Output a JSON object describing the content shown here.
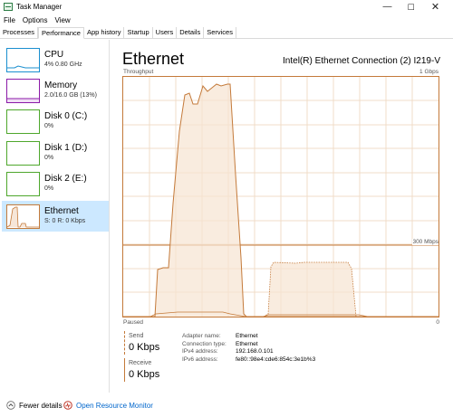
{
  "window": {
    "title": "Task Manager",
    "minimize_glyph": "—",
    "maximize_glyph": "☐",
    "close_glyph": "✕"
  },
  "menu": [
    "File",
    "Options",
    "View"
  ],
  "tabs": [
    "Processes",
    "Performance",
    "App history",
    "Startup",
    "Users",
    "Details",
    "Services"
  ],
  "active_tab": "Performance",
  "sidebar": {
    "items": [
      {
        "title": "CPU",
        "sub": "4% 0.80 GHz",
        "color": "#1a8fcf"
      },
      {
        "title": "Memory",
        "sub": "2.0/16.0 GB (13%)",
        "color": "#8b1aa8"
      },
      {
        "title": "Disk 0 (C:)",
        "sub": "0%",
        "color": "#4ea72c"
      },
      {
        "title": "Disk 1 (D:)",
        "sub": "0%",
        "color": "#4ea72c"
      },
      {
        "title": "Disk 2 (E:)",
        "sub": "0%",
        "color": "#4ea72c"
      },
      {
        "title": "Ethernet",
        "sub": "S: 0 R: 0 Kbps",
        "color": "#c47a3a"
      }
    ],
    "selected": "Ethernet"
  },
  "main": {
    "title": "Ethernet",
    "adapter": "Intel(R) Ethernet Connection (2) I219-V",
    "throughput_label": "Throughput",
    "max_label": "1 Gbps",
    "mid_label": "300 Mbps",
    "paused_label": "Paused",
    "zero_label": "0"
  },
  "stats": {
    "send_label": "Send",
    "send_value": "0 Kbps",
    "receive_label": "Receive",
    "receive_value": "0 Kbps"
  },
  "details": [
    {
      "label": "Adapter name:",
      "value": "Ethernet"
    },
    {
      "label": "Connection type:",
      "value": "Ethernet"
    },
    {
      "label": "IPv4 address:",
      "value": "192.168.0.101"
    },
    {
      "label": "IPv6 address:",
      "value": "fe80::98e4:cde6:854c:3e1b%3"
    }
  ],
  "footer": {
    "fewer_details": "Fewer details",
    "open_resource_monitor": "Open Resource Monitor"
  },
  "colors": {
    "accent": "#c47a3a",
    "selected_bg": "#cce8ff",
    "link": "#0066cc"
  }
}
